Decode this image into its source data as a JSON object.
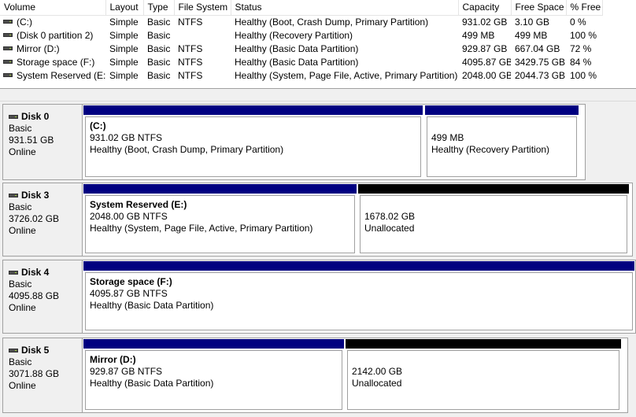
{
  "columns": [
    "Volume",
    "Layout",
    "Type",
    "File System",
    "Status",
    "Capacity",
    "Free Space",
    "% Free"
  ],
  "volumes": [
    {
      "volume": "(C:)",
      "layout": "Simple",
      "type": "Basic",
      "fs": "NTFS",
      "status": "Healthy (Boot, Crash Dump, Primary Partition)",
      "capacity": "931.02 GB",
      "free": "3.10 GB",
      "pct": "0 %"
    },
    {
      "volume": "(Disk 0 partition 2)",
      "layout": "Simple",
      "type": "Basic",
      "fs": "",
      "status": "Healthy (Recovery Partition)",
      "capacity": "499 MB",
      "free": "499 MB",
      "pct": "100 %"
    },
    {
      "volume": "Mirror (D:)",
      "layout": "Simple",
      "type": "Basic",
      "fs": "NTFS",
      "status": "Healthy (Basic Data Partition)",
      "capacity": "929.87 GB",
      "free": "667.04 GB",
      "pct": "72 %"
    },
    {
      "volume": "Storage space (F:)",
      "layout": "Simple",
      "type": "Basic",
      "fs": "NTFS",
      "status": "Healthy (Basic Data Partition)",
      "capacity": "4095.87 GB",
      "free": "3429.75 GB",
      "pct": "84 %"
    },
    {
      "volume": "System Reserved (E:)",
      "layout": "Simple",
      "type": "Basic",
      "fs": "NTFS",
      "status": "Healthy (System, Page File, Active, Primary Partition)",
      "capacity": "2048.00 GB",
      "free": "2044.73 GB",
      "pct": "100 %"
    }
  ],
  "disks": [
    {
      "name": "Disk 0",
      "type": "Basic",
      "size": "931.51 GB",
      "status": "Online",
      "partitions": [
        {
          "title": "(C:)",
          "size": "931.02 GB NTFS",
          "status": "Healthy (Boot, Crash Dump, Primary Partition)",
          "kind": "primary"
        },
        {
          "title": "",
          "size": "499 MB",
          "status": "Healthy (Recovery Partition)",
          "kind": "primary"
        }
      ]
    },
    {
      "name": "Disk 3",
      "type": "Basic",
      "size": "3726.02 GB",
      "status": "Online",
      "partitions": [
        {
          "title": "System Reserved  (E:)",
          "size": "2048.00 GB NTFS",
          "status": "Healthy (System, Page File, Active, Primary Partition)",
          "kind": "primary"
        },
        {
          "title": "",
          "size": "1678.02 GB",
          "status": "Unallocated",
          "kind": "unallocated"
        }
      ]
    },
    {
      "name": "Disk 4",
      "type": "Basic",
      "size": "4095.88 GB",
      "status": "Online",
      "partitions": [
        {
          "title": "Storage space  (F:)",
          "size": "4095.87 GB NTFS",
          "status": "Healthy (Basic Data Partition)",
          "kind": "primary"
        }
      ]
    },
    {
      "name": "Disk 5",
      "type": "Basic",
      "size": "3071.88 GB",
      "status": "Online",
      "partitions": [
        {
          "title": "Mirror  (D:)",
          "size": "929.87 GB NTFS",
          "status": "Healthy (Basic Data Partition)",
          "kind": "primary"
        },
        {
          "title": "",
          "size": "2142.00 GB",
          "status": "Unallocated",
          "kind": "unallocated"
        }
      ]
    }
  ]
}
